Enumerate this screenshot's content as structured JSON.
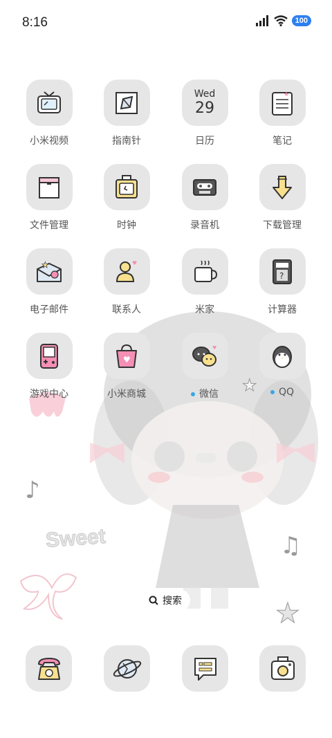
{
  "status_bar": {
    "time": "8:16",
    "battery": "100"
  },
  "apps": {
    "mi_video": "小米视频",
    "compass": "指南针",
    "calendar": "日历",
    "calendar_weekday": "Wed",
    "calendar_day": "29",
    "notes": "笔记",
    "file_manager": "文件管理",
    "clock": "时钟",
    "recorder": "录音机",
    "downloads": "下载管理",
    "email": "电子邮件",
    "contacts": "联系人",
    "mi_home": "米家",
    "calculator": "计算器",
    "game_center": "游戏中心",
    "mi_store": "小米商城",
    "wechat": "微信",
    "qq": "QQ"
  },
  "background_text": "Sweet",
  "search": {
    "label": "搜索"
  },
  "dock": [
    "phone-icon",
    "browser-icon",
    "messages-icon",
    "camera-icon"
  ],
  "colors": {
    "tile": "#e6e6e6",
    "accent_pink": "#f58fb4",
    "accent_yellow": "#f8e08e",
    "new_dot": "#36a7e6",
    "battery": "#2d7ff0"
  }
}
